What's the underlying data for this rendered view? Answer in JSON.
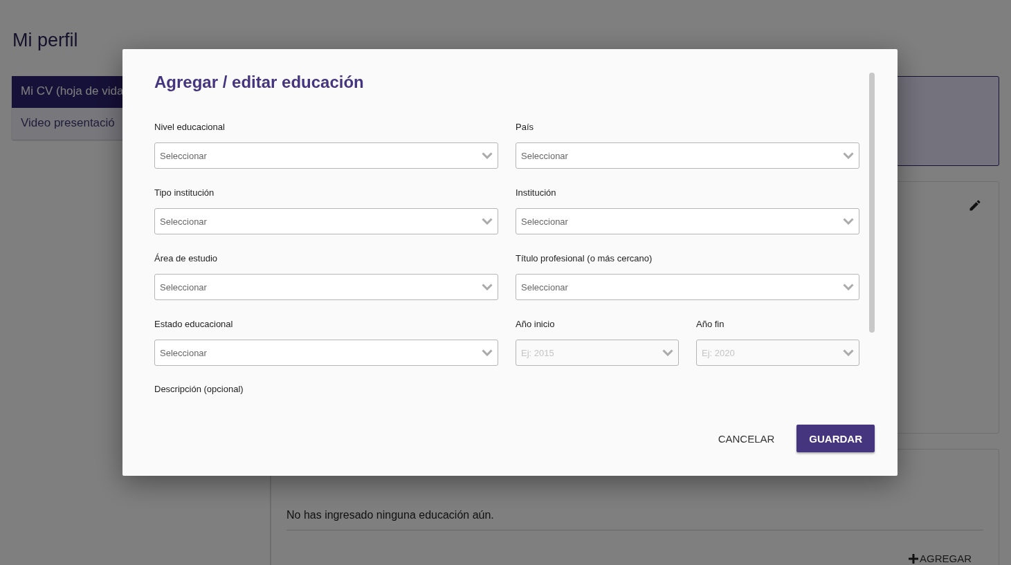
{
  "page": {
    "title": "Mi perfil"
  },
  "sidebar": {
    "items": [
      {
        "label": "Mi CV (hoja de vida",
        "selected": true
      },
      {
        "label": "Video presentació",
        "selected": false
      }
    ]
  },
  "education_section": {
    "empty_message": "No has ingresado ninguna educación aún.",
    "add_button": "AGREGAR"
  },
  "dialog": {
    "title": "Agregar / editar educación",
    "fields": [
      {
        "label": "Nivel educacional",
        "placeholder": "Seleccionar",
        "kind": "wide",
        "disabled": false
      },
      {
        "label": "País",
        "placeholder": "Seleccionar",
        "kind": "wide",
        "disabled": false
      },
      {
        "label": "Tipo institución",
        "placeholder": "Seleccionar",
        "kind": "wide",
        "disabled": false
      },
      {
        "label": "Institución",
        "placeholder": "Seleccionar",
        "kind": "wide",
        "disabled": false
      },
      {
        "label": "Área de estudio",
        "placeholder": "Seleccionar",
        "kind": "wide",
        "disabled": false
      },
      {
        "label": "Título profesional (o más cercano)",
        "placeholder": "Seleccionar",
        "kind": "wide",
        "disabled": false
      },
      {
        "label": "Estado educacional",
        "placeholder": "Seleccionar",
        "kind": "wide",
        "disabled": false
      },
      {
        "label": "Año inicio",
        "placeholder": "Ej: 2015",
        "kind": "narrow",
        "disabled": true
      },
      {
        "label": "Año fin",
        "placeholder": "Ej: 2020",
        "kind": "narrow",
        "disabled": true
      }
    ],
    "description_label": "Descripción (opcional)",
    "buttons": [
      {
        "label": "CANCELAR",
        "kind": "text"
      },
      {
        "label": "GUARDAR",
        "kind": "primary"
      }
    ]
  }
}
